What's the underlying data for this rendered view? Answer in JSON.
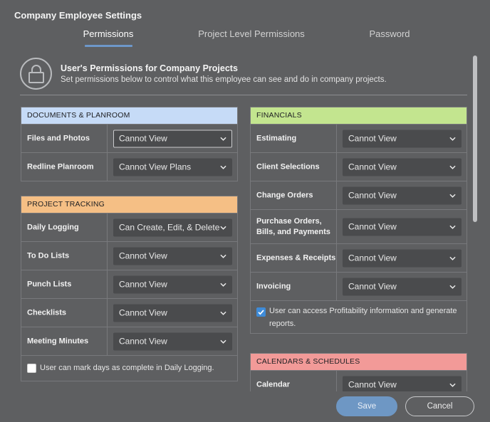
{
  "window": {
    "title": "Company Employee Settings"
  },
  "tabs": [
    {
      "label": "Permissions",
      "active": true
    },
    {
      "label": "Project Level Permissions",
      "active": false
    },
    {
      "label": "Password",
      "active": false
    }
  ],
  "intro": {
    "icon": "lock-icon",
    "title": "User's Permissions for Company Projects",
    "subtitle": "Set permissions below to control what this employee can see and do in company projects."
  },
  "sections": {
    "documents": {
      "header": "DOCUMENTS & PLANROOM",
      "color": "#c6dbf7",
      "rows": [
        {
          "label": "Files and Photos",
          "value": "Cannot View"
        },
        {
          "label": "Redline Planroom",
          "value": "Cannot View Plans"
        }
      ]
    },
    "project_tracking": {
      "header": "PROJECT TRACKING",
      "color": "#f5bf85",
      "rows": [
        {
          "label": "Daily Logging",
          "value": "Can Create, Edit, & Delete"
        },
        {
          "label": "To Do Lists",
          "value": "Cannot View"
        },
        {
          "label": "Punch Lists",
          "value": "Cannot View"
        },
        {
          "label": "Checklists",
          "value": "Cannot View"
        },
        {
          "label": "Meeting Minutes",
          "value": "Cannot View"
        }
      ],
      "checkbox": {
        "label": "User can mark days as complete in Daily Logging.",
        "checked": false
      }
    },
    "financials": {
      "header": "FINANCIALS",
      "color": "#c3e58f",
      "rows": [
        {
          "label": "Estimating",
          "value": "Cannot View"
        },
        {
          "label": "Client Selections",
          "value": "Cannot View"
        },
        {
          "label": "Change Orders",
          "value": "Cannot View"
        },
        {
          "label_line1": "Purchase Orders,",
          "label_line2": "Bills, and Payments",
          "value": "Cannot View"
        },
        {
          "label": "Expenses & Receipts",
          "value": "Cannot View"
        },
        {
          "label": "Invoicing",
          "value": "Cannot View"
        }
      ],
      "checkbox": {
        "label_line1": "User can access Profitability information and generate",
        "label_line2": "reports.",
        "checked": true
      }
    },
    "calendars": {
      "header": "CALENDARS & SCHEDULES",
      "color": "#f29a98",
      "rows": [
        {
          "label": "Calendar",
          "value": "Cannot View"
        }
      ]
    }
  },
  "footer": {
    "save_label": "Save",
    "cancel_label": "Cancel",
    "save_color": "#6e97c4"
  },
  "icons": {
    "dropdown": "chevron-down-icon",
    "check": "check-icon"
  }
}
